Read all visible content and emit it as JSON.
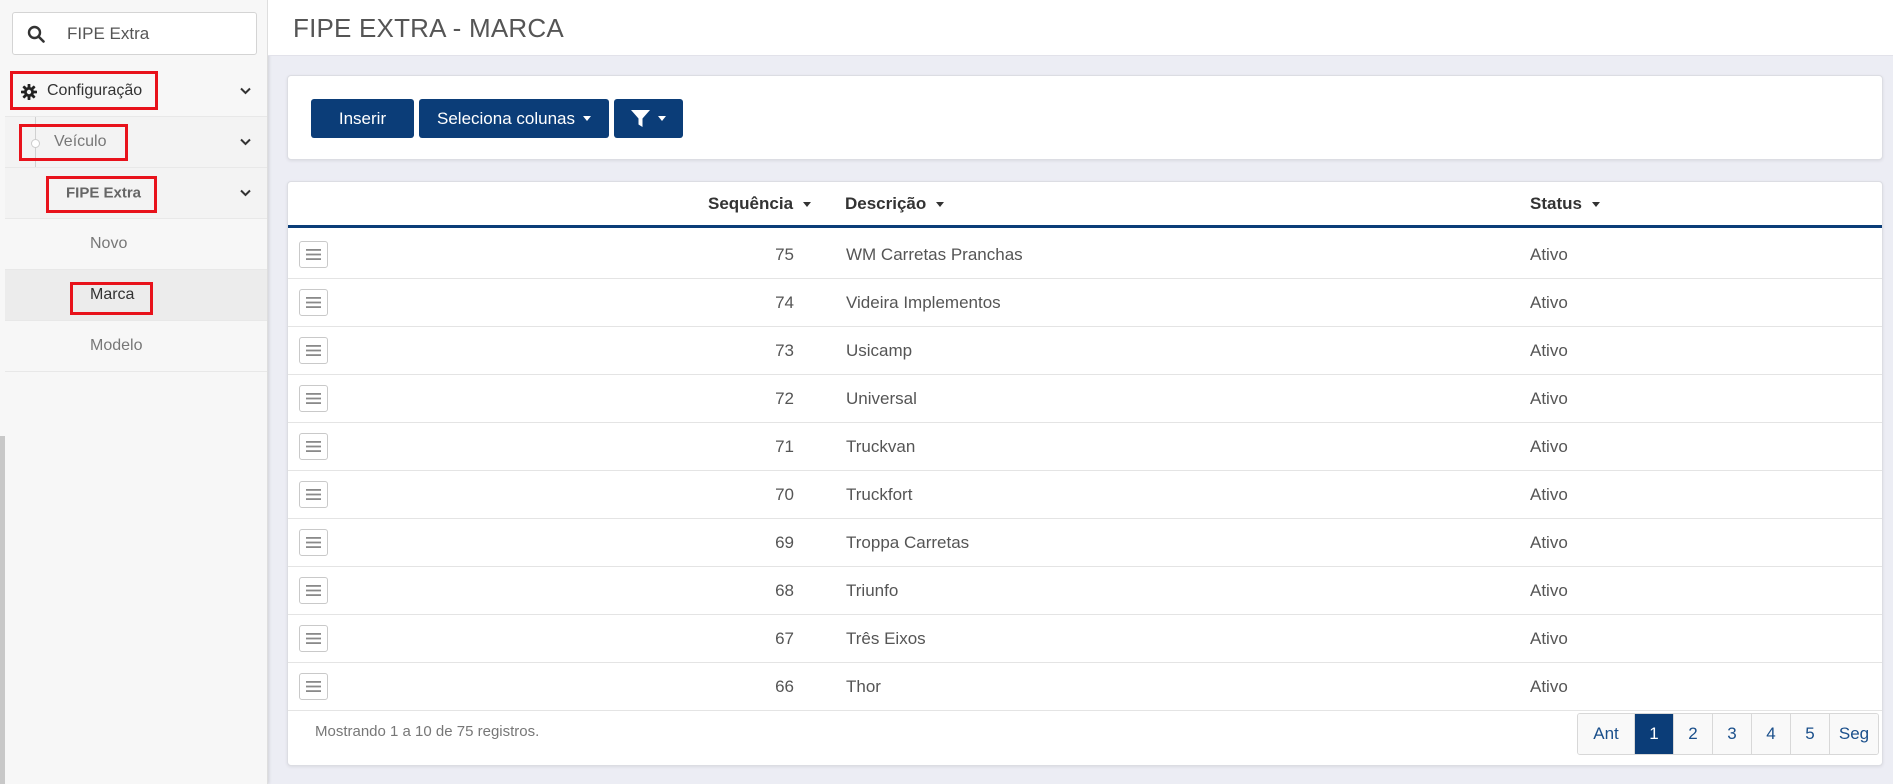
{
  "sidebar": {
    "search_value": "FIPE Extra",
    "items": [
      {
        "label": "Configuração"
      },
      {
        "label": "Veículo"
      },
      {
        "label": "FIPE Extra"
      },
      {
        "label": "Novo"
      },
      {
        "label": "Marca"
      },
      {
        "label": "Modelo"
      }
    ]
  },
  "header": {
    "title": "FIPE EXTRA - MARCA"
  },
  "toolbar": {
    "insert_label": "Inserir",
    "columns_label": "Seleciona colunas"
  },
  "table": {
    "columns": [
      "Sequência",
      "Descrição",
      "Status"
    ],
    "rows": [
      {
        "seq": "75",
        "desc": "WM Carretas Pranchas",
        "status": "Ativo"
      },
      {
        "seq": "74",
        "desc": "Videira Implementos",
        "status": "Ativo"
      },
      {
        "seq": "73",
        "desc": "Usicamp",
        "status": "Ativo"
      },
      {
        "seq": "72",
        "desc": "Universal",
        "status": "Ativo"
      },
      {
        "seq": "71",
        "desc": "Truckvan",
        "status": "Ativo"
      },
      {
        "seq": "70",
        "desc": "Truckfort",
        "status": "Ativo"
      },
      {
        "seq": "69",
        "desc": "Troppa Carretas",
        "status": "Ativo"
      },
      {
        "seq": "68",
        "desc": "Triunfo",
        "status": "Ativo"
      },
      {
        "seq": "67",
        "desc": "Três Eixos",
        "status": "Ativo"
      },
      {
        "seq": "66",
        "desc": "Thor",
        "status": "Ativo"
      }
    ]
  },
  "footer": {
    "info": "Mostrando 1 a 10 de 75 registros.",
    "pagination": [
      "Ant",
      "1",
      "2",
      "3",
      "4",
      "5",
      "Seg"
    ],
    "active_page": "1"
  },
  "colors": {
    "primary": "#0b3d78",
    "highlight": "#e8121b"
  }
}
